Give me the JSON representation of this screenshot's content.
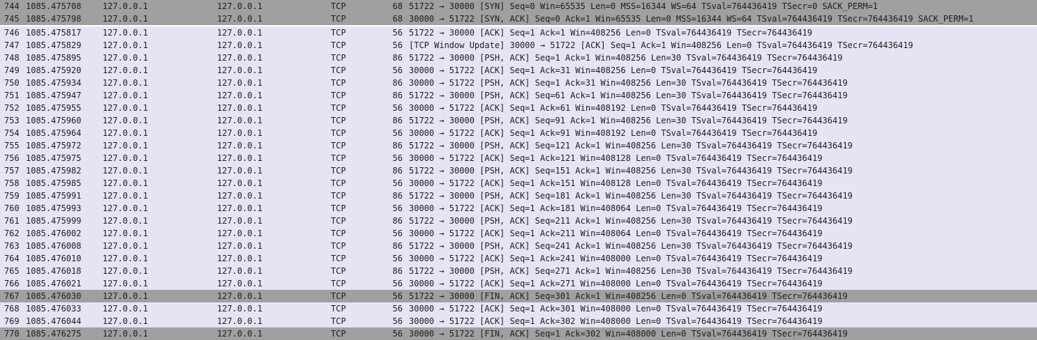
{
  "packets": [
    {
      "no": "744",
      "time": "1085.475708",
      "source": "127.0.0.1",
      "destination": "127.0.0.1",
      "protocol": "TCP",
      "length": "68",
      "info": "51722 → 30000 [SYN] Seq=0 Win=65535 Len=0 MSS=16344 WS=64 TSval=764436419 TSecr=0 SACK_PERM=1",
      "style": "syn-fin"
    },
    {
      "no": "745",
      "time": "1085.475798",
      "source": "127.0.0.1",
      "destination": "127.0.0.1",
      "protocol": "TCP",
      "length": "68",
      "info": "30000 → 51722 [SYN, ACK] Seq=0 Ack=1 Win=65535 Len=0 MSS=16344 WS=64 TSval=764436419 TSecr=764436419 SACK_PERM=1",
      "style": "syn-fin"
    },
    {
      "no": "746",
      "time": "1085.475817",
      "source": "127.0.0.1",
      "destination": "127.0.0.1",
      "protocol": "TCP",
      "length": "56",
      "info": "51722 → 30000 [ACK] Seq=1 Ack=1 Win=408256 Len=0 TSval=764436419 TSecr=764436419",
      "style": "normal"
    },
    {
      "no": "747",
      "time": "1085.475829",
      "source": "127.0.0.1",
      "destination": "127.0.0.1",
      "protocol": "TCP",
      "length": "56",
      "info": "[TCP Window Update] 30000 → 51722 [ACK] Seq=1 Ack=1 Win=408256 Len=0 TSval=764436419 TSecr=764436419",
      "style": "normal"
    },
    {
      "no": "748",
      "time": "1085.475895",
      "source": "127.0.0.1",
      "destination": "127.0.0.1",
      "protocol": "TCP",
      "length": "86",
      "info": "51722 → 30000 [PSH, ACK] Seq=1 Ack=1 Win=408256 Len=30 TSval=764436419 TSecr=764436419",
      "style": "normal"
    },
    {
      "no": "749",
      "time": "1085.475920",
      "source": "127.0.0.1",
      "destination": "127.0.0.1",
      "protocol": "TCP",
      "length": "56",
      "info": "30000 → 51722 [ACK] Seq=1 Ack=31 Win=408256 Len=0 TSval=764436419 TSecr=764436419",
      "style": "normal"
    },
    {
      "no": "750",
      "time": "1085.475934",
      "source": "127.0.0.1",
      "destination": "127.0.0.1",
      "protocol": "TCP",
      "length": "86",
      "info": "30000 → 51722 [PSH, ACK] Seq=1 Ack=31 Win=408256 Len=30 TSval=764436419 TSecr=764436419",
      "style": "normal"
    },
    {
      "no": "751",
      "time": "1085.475947",
      "source": "127.0.0.1",
      "destination": "127.0.0.1",
      "protocol": "TCP",
      "length": "86",
      "info": "51722 → 30000 [PSH, ACK] Seq=61 Ack=1 Win=408256 Len=30 TSval=764436419 TSecr=764436419",
      "style": "normal"
    },
    {
      "no": "752",
      "time": "1085.475955",
      "source": "127.0.0.1",
      "destination": "127.0.0.1",
      "protocol": "TCP",
      "length": "56",
      "info": "30000 → 51722 [ACK] Seq=1 Ack=61 Win=408192 Len=0 TSval=764436419 TSecr=764436419",
      "style": "normal"
    },
    {
      "no": "753",
      "time": "1085.475960",
      "source": "127.0.0.1",
      "destination": "127.0.0.1",
      "protocol": "TCP",
      "length": "86",
      "info": "51722 → 30000 [PSH, ACK] Seq=91 Ack=1 Win=408256 Len=30 TSval=764436419 TSecr=764436419",
      "style": "normal"
    },
    {
      "no": "754",
      "time": "1085.475964",
      "source": "127.0.0.1",
      "destination": "127.0.0.1",
      "protocol": "TCP",
      "length": "56",
      "info": "30000 → 51722 [ACK] Seq=1 Ack=91 Win=408192 Len=0 TSval=764436419 TSecr=764436419",
      "style": "normal"
    },
    {
      "no": "755",
      "time": "1085.475972",
      "source": "127.0.0.1",
      "destination": "127.0.0.1",
      "protocol": "TCP",
      "length": "86",
      "info": "51722 → 30000 [PSH, ACK] Seq=121 Ack=1 Win=408256 Len=30 TSval=764436419 TSecr=764436419",
      "style": "normal"
    },
    {
      "no": "756",
      "time": "1085.475975",
      "source": "127.0.0.1",
      "destination": "127.0.0.1",
      "protocol": "TCP",
      "length": "56",
      "info": "30000 → 51722 [ACK] Seq=1 Ack=121 Win=408128 Len=0 TSval=764436419 TSecr=764436419",
      "style": "normal"
    },
    {
      "no": "757",
      "time": "1085.475982",
      "source": "127.0.0.1",
      "destination": "127.0.0.1",
      "protocol": "TCP",
      "length": "86",
      "info": "51722 → 30000 [PSH, ACK] Seq=151 Ack=1 Win=408256 Len=30 TSval=764436419 TSecr=764436419",
      "style": "normal"
    },
    {
      "no": "758",
      "time": "1085.475985",
      "source": "127.0.0.1",
      "destination": "127.0.0.1",
      "protocol": "TCP",
      "length": "56",
      "info": "30000 → 51722 [ACK] Seq=1 Ack=151 Win=408128 Len=0 TSval=764436419 TSecr=764436419",
      "style": "normal"
    },
    {
      "no": "759",
      "time": "1085.475991",
      "source": "127.0.0.1",
      "destination": "127.0.0.1",
      "protocol": "TCP",
      "length": "86",
      "info": "51722 → 30000 [PSH, ACK] Seq=181 Ack=1 Win=408256 Len=30 TSval=764436419 TSecr=764436419",
      "style": "normal"
    },
    {
      "no": "760",
      "time": "1085.475993",
      "source": "127.0.0.1",
      "destination": "127.0.0.1",
      "protocol": "TCP",
      "length": "56",
      "info": "30000 → 51722 [ACK] Seq=1 Ack=181 Win=408064 Len=0 TSval=764436419 TSecr=764436419",
      "style": "normal"
    },
    {
      "no": "761",
      "time": "1085.475999",
      "source": "127.0.0.1",
      "destination": "127.0.0.1",
      "protocol": "TCP",
      "length": "86",
      "info": "51722 → 30000 [PSH, ACK] Seq=211 Ack=1 Win=408256 Len=30 TSval=764436419 TSecr=764436419",
      "style": "normal"
    },
    {
      "no": "762",
      "time": "1085.476002",
      "source": "127.0.0.1",
      "destination": "127.0.0.1",
      "protocol": "TCP",
      "length": "56",
      "info": "30000 → 51722 [ACK] Seq=1 Ack=211 Win=408064 Len=0 TSval=764436419 TSecr=764436419",
      "style": "normal"
    },
    {
      "no": "763",
      "time": "1085.476008",
      "source": "127.0.0.1",
      "destination": "127.0.0.1",
      "protocol": "TCP",
      "length": "86",
      "info": "51722 → 30000 [PSH, ACK] Seq=241 Ack=1 Win=408256 Len=30 TSval=764436419 TSecr=764436419",
      "style": "normal"
    },
    {
      "no": "764",
      "time": "1085.476010",
      "source": "127.0.0.1",
      "destination": "127.0.0.1",
      "protocol": "TCP",
      "length": "56",
      "info": "30000 → 51722 [ACK] Seq=1 Ack=241 Win=408000 Len=0 TSval=764436419 TSecr=764436419",
      "style": "normal"
    },
    {
      "no": "765",
      "time": "1085.476018",
      "source": "127.0.0.1",
      "destination": "127.0.0.1",
      "protocol": "TCP",
      "length": "86",
      "info": "51722 → 30000 [PSH, ACK] Seq=271 Ack=1 Win=408256 Len=30 TSval=764436419 TSecr=764436419",
      "style": "normal"
    },
    {
      "no": "766",
      "time": "1085.476021",
      "source": "127.0.0.1",
      "destination": "127.0.0.1",
      "protocol": "TCP",
      "length": "56",
      "info": "30000 → 51722 [ACK] Seq=1 Ack=271 Win=408000 Len=0 TSval=764436419 TSecr=764436419",
      "style": "normal"
    },
    {
      "no": "767",
      "time": "1085.476030",
      "source": "127.0.0.1",
      "destination": "127.0.0.1",
      "protocol": "TCP",
      "length": "56",
      "info": "51722 → 30000 [FIN, ACK] Seq=301 Ack=1 Win=408256 Len=0 TSval=764436419 TSecr=764436419",
      "style": "syn-fin"
    },
    {
      "no": "768",
      "time": "1085.476033",
      "source": "127.0.0.1",
      "destination": "127.0.0.1",
      "protocol": "TCP",
      "length": "56",
      "info": "30000 → 51722 [ACK] Seq=1 Ack=301 Win=408000 Len=0 TSval=764436419 TSecr=764436419",
      "style": "normal"
    },
    {
      "no": "769",
      "time": "1085.476044",
      "source": "127.0.0.1",
      "destination": "127.0.0.1",
      "protocol": "TCP",
      "length": "56",
      "info": "30000 → 51722 [ACK] Seq=1 Ack=302 Win=408000 Len=0 TSval=764436419 TSecr=764436419",
      "style": "normal"
    },
    {
      "no": "770",
      "time": "1085.476275",
      "source": "127.0.0.1",
      "destination": "127.0.0.1",
      "protocol": "TCP",
      "length": "56",
      "info": "30000 → 51722 [FIN, ACK] Seq=1 Ack=302 Win=408000 Len=0 TSval=764436419 TSecr=764436419",
      "style": "syn-fin"
    }
  ],
  "colors": {
    "syn_fin_row_bg": "#a0a0a0",
    "normal_row_bg": "#e4e4f5",
    "text": "#1d1d1d"
  }
}
